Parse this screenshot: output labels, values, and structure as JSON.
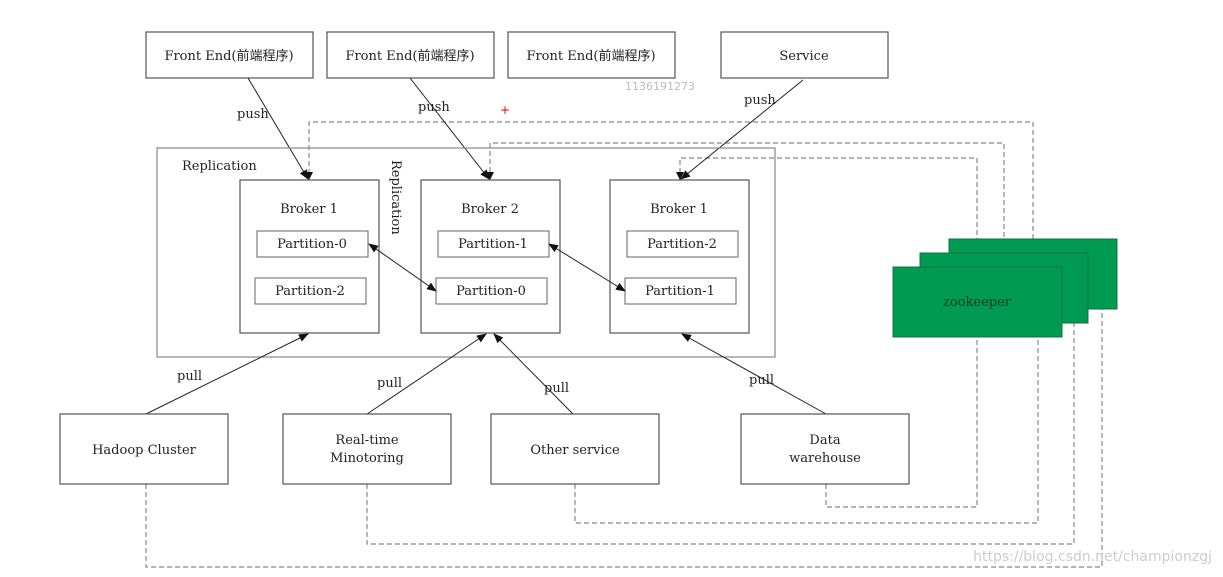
{
  "colors": {
    "zookeeper": "#009a50",
    "marker": "#e00000"
  },
  "producers": [
    "Front End(前端程序)",
    "Front End(前端程序)",
    "Front End(前端程序)",
    "Service"
  ],
  "edge_labels": {
    "push": "push",
    "pull": "pull"
  },
  "id_text": "1136191273",
  "marker": "+",
  "replication": {
    "outer_label": "Replication",
    "vertical_label": "Replication"
  },
  "brokers": [
    {
      "name": "Broker 1",
      "partitions": [
        "Partition-0",
        "Partition-2"
      ]
    },
    {
      "name": "Broker 2",
      "partitions": [
        "Partition-1",
        "Partition-0"
      ]
    },
    {
      "name": "Broker 1",
      "partitions": [
        "Partition-2",
        "Partition-1"
      ]
    }
  ],
  "zookeeper": "zookeeper",
  "consumers": [
    [
      "Hadoop Cluster"
    ],
    [
      "Real-time",
      "Minotoring"
    ],
    [
      "Other service"
    ],
    [
      "Data",
      "warehouse"
    ]
  ],
  "watermark": "https://blog.csdn.net/championzgj"
}
